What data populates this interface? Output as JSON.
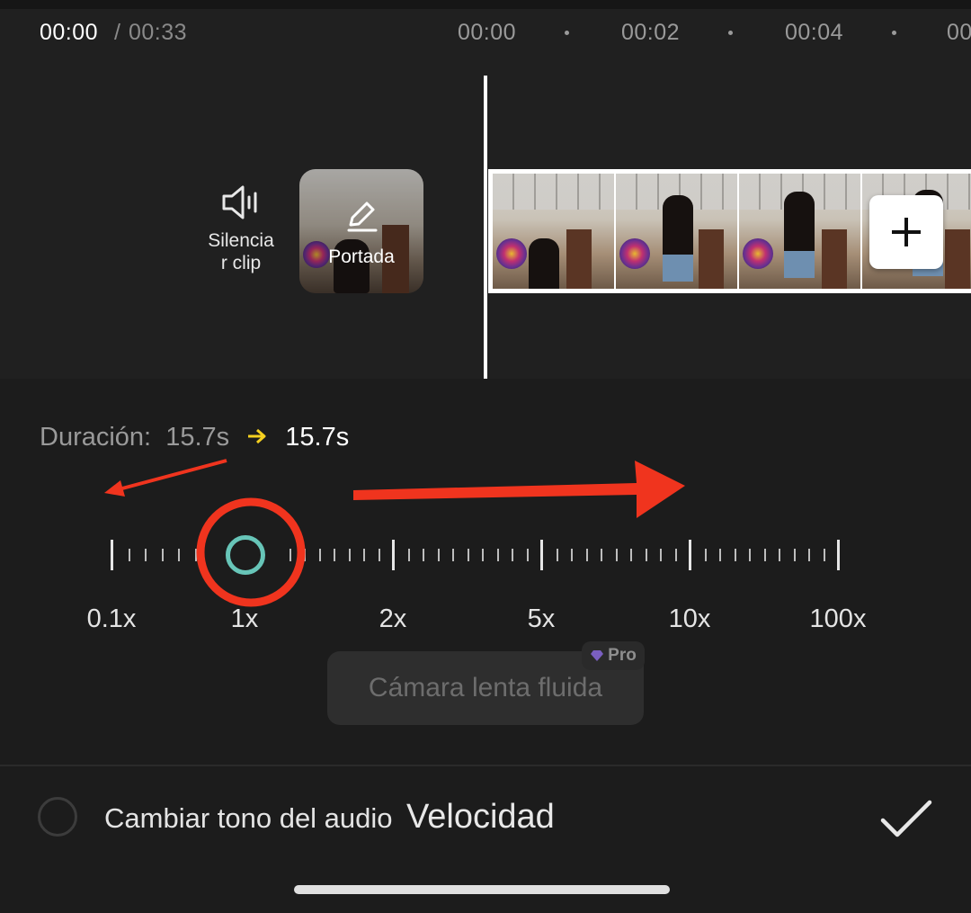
{
  "timeline": {
    "current_time": "00:00",
    "separator": "/",
    "total_time": "00:33",
    "ruler": [
      "00:00",
      "00:02",
      "00:04",
      "00"
    ]
  },
  "clip_tools": {
    "mute_label": "Silencia\nr clip",
    "cover_label": "Portada"
  },
  "speed_panel": {
    "duration_label": "Duración:",
    "duration_original": "15.7s",
    "duration_new": "15.7s",
    "speed_markers": [
      "0.1x",
      "1x",
      "2x",
      "5x",
      "10x",
      "100x"
    ],
    "current_speed": 1,
    "smooth_slowmo_label": "Cámara lenta fluida",
    "pro_badge": "Pro"
  },
  "bottom_bar": {
    "pitch_label": "Cambiar tono del audio",
    "title": "Velocidad"
  },
  "colors": {
    "background": "#1c1c1c",
    "accent_teal": "#67c5b8",
    "arrow_yellow": "#f5d020",
    "annotation_red": "#f0341e"
  }
}
